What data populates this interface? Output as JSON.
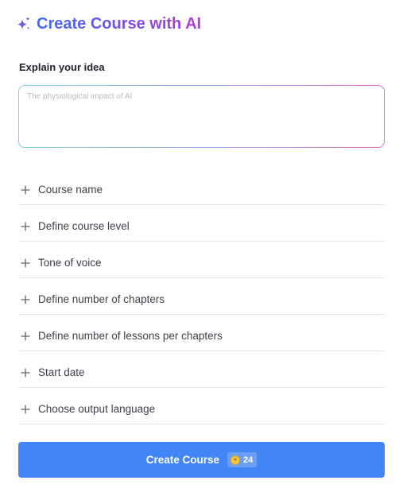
{
  "header": {
    "title": "Create Course with AI",
    "icon": "sparkle-icon",
    "gradient": [
      "#3b6ef2",
      "#7c4be0",
      "#b23fd6"
    ]
  },
  "idea": {
    "label": "Explain your idea",
    "placeholder": "The physiological impact of AI",
    "value": ""
  },
  "options": [
    {
      "label": "Course name",
      "icon": "plus-icon"
    },
    {
      "label": "Define course level",
      "icon": "plus-icon"
    },
    {
      "label": "Tone of voice",
      "icon": "plus-icon"
    },
    {
      "label": "Define number of chapters",
      "icon": "plus-icon"
    },
    {
      "label": "Define number of lessons per chapters",
      "icon": "plus-icon"
    },
    {
      "label": "Start date",
      "icon": "plus-icon"
    },
    {
      "label": "Choose output language",
      "icon": "plus-icon"
    }
  ],
  "submit": {
    "label": "Create Course",
    "credits": "24",
    "coin_icon": "coin-icon",
    "color": "#4285f4"
  }
}
